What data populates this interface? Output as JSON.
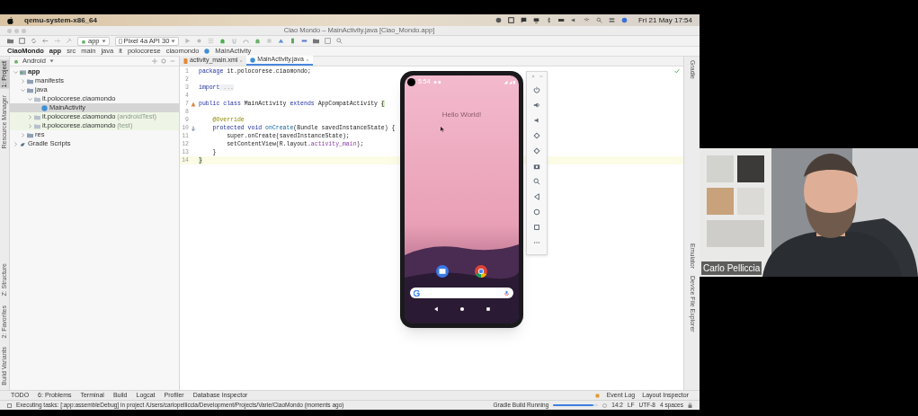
{
  "menubar": {
    "app": "qemu-system-x86_64",
    "clock": "Fri 21 May 17:54"
  },
  "window": {
    "title": "Ciao Mondo – MainActivity.java [Ciao_Mondo.app]"
  },
  "toolbar": {
    "module": "app",
    "device": "Pixel 4a API 30"
  },
  "breadcrumbs": [
    "CiaoMondo",
    "app",
    "src",
    "main",
    "java",
    "it",
    "polocorese",
    "ciaomondo",
    "MainActivity"
  ],
  "left_strip": {
    "top": [
      {
        "label": "1: Project",
        "selected": true
      },
      {
        "label": "Resource Manager",
        "selected": false
      }
    ],
    "bottom": [
      {
        "label": "Z: Structure",
        "selected": false
      },
      {
        "label": "2: Favorites",
        "selected": false
      },
      {
        "label": "Build Variants",
        "selected": false
      }
    ]
  },
  "project": {
    "view": "Android",
    "tree": [
      {
        "label": "app",
        "kind": "module",
        "expanded": true,
        "selected": false,
        "children": [
          {
            "label": "manifests",
            "kind": "folder",
            "expanded": false,
            "selected": false
          },
          {
            "label": "java",
            "kind": "folder",
            "expanded": true,
            "selected": false,
            "children": [
              {
                "label": "it.polocorese.ciaomondo",
                "kind": "package",
                "expanded": true,
                "selected": false,
                "children": [
                  {
                    "label": "MainActivity",
                    "kind": "class",
                    "selected": true
                  }
                ]
              },
              {
                "label": "it.polocorese.ciaomondo",
                "suffix": "(androidTest)",
                "kind": "package",
                "expanded": false,
                "selected": false
              },
              {
                "label": "it.polocorese.ciaomondo",
                "suffix": "(test)",
                "kind": "package",
                "expanded": false,
                "selected": false
              }
            ]
          },
          {
            "label": "res",
            "kind": "folder",
            "expanded": false,
            "selected": false
          }
        ]
      },
      {
        "label": "Gradle Scripts",
        "kind": "gradle",
        "expanded": false,
        "selected": false
      }
    ]
  },
  "tabs": [
    {
      "label": "activity_main.xml",
      "kind": "xml",
      "selected": false
    },
    {
      "label": "MainActivity.java",
      "kind": "java",
      "selected": true
    }
  ],
  "code": [
    {
      "number": "1",
      "kind": "plain",
      "current": false,
      "parts": [
        {
          "kind": "keyword",
          "text": "package"
        },
        {
          "kind": "plain",
          "text": " it.polocorese.ciaomondo;"
        }
      ]
    },
    {
      "number": "2",
      "kind": "plain",
      "current": false
    },
    {
      "number": "3",
      "kind": "plain",
      "current": false,
      "parts": [
        {
          "kind": "keyword",
          "text": "import"
        },
        {
          "kind": "folded",
          "text": " ..."
        }
      ]
    },
    {
      "number": "4",
      "kind": "plain",
      "current": false
    },
    {
      "number": "7",
      "kind": "run",
      "current": false,
      "parts": [
        {
          "kind": "keyword",
          "text": "public class"
        },
        {
          "kind": "plain",
          "text": " MainActivity "
        },
        {
          "kind": "keyword",
          "text": "extends"
        },
        {
          "kind": "plain",
          "text": " AppCompatActivity "
        },
        {
          "kind": "brace",
          "text": "{"
        }
      ]
    },
    {
      "number": "8",
      "kind": "plain",
      "current": false
    },
    {
      "number": "9",
      "kind": "plain",
      "current": false,
      "parts": [
        {
          "kind": "annotation",
          "text": "    @Override"
        }
      ]
    },
    {
      "number": "10",
      "kind": "override",
      "current": false,
      "parts": [
        {
          "kind": "keyword",
          "text": "    protected void"
        },
        {
          "kind": "method",
          "text": " onCreate"
        },
        {
          "kind": "plain",
          "text": "(Bundle savedInstanceState) {"
        }
      ]
    },
    {
      "number": "11",
      "kind": "plain",
      "current": false,
      "parts": [
        {
          "kind": "plain",
          "text": "        super.onCreate(savedInstanceState);"
        }
      ]
    },
    {
      "number": "12",
      "kind": "plain",
      "current": false,
      "parts": [
        {
          "kind": "plain",
          "text": "        setContentView(R.layout."
        },
        {
          "kind": "field",
          "text": "activity_main"
        },
        {
          "kind": "plain",
          "text": ");"
        }
      ]
    },
    {
      "number": "13",
      "kind": "plain",
      "current": false,
      "parts": [
        {
          "kind": "plain",
          "text": "    }"
        }
      ]
    },
    {
      "number": "14",
      "kind": "plain",
      "current": true,
      "parts": [
        {
          "kind": "brace",
          "text": "}"
        }
      ]
    }
  ],
  "emulator": {
    "time": "5:54",
    "text": "Hello World!"
  },
  "right_strip": {
    "top": [
      "Gradle"
    ],
    "bottom": [
      "Emulator",
      "Device File Explorer"
    ]
  },
  "bottom_tools": {
    "left": [
      "TODO",
      "6: Problems",
      "Terminal",
      "Build",
      "Logcat",
      "Profiler",
      "Database Inspector"
    ],
    "right": [
      "Event Log",
      "Layout Inspector"
    ]
  },
  "status": {
    "message": "Executing tasks: [:app:assembleDebug] in project /Users/carlopelliccia/Development/Projects/Varie/CiaoMondo (moments ago)",
    "task": "Gradle Build Running",
    "level": 0.9,
    "position": "14:2",
    "line_ending": "LF",
    "encoding": "UTF-8",
    "indent": "4 spaces"
  },
  "webcam": {
    "name": "Carlo Pelliccia"
  }
}
